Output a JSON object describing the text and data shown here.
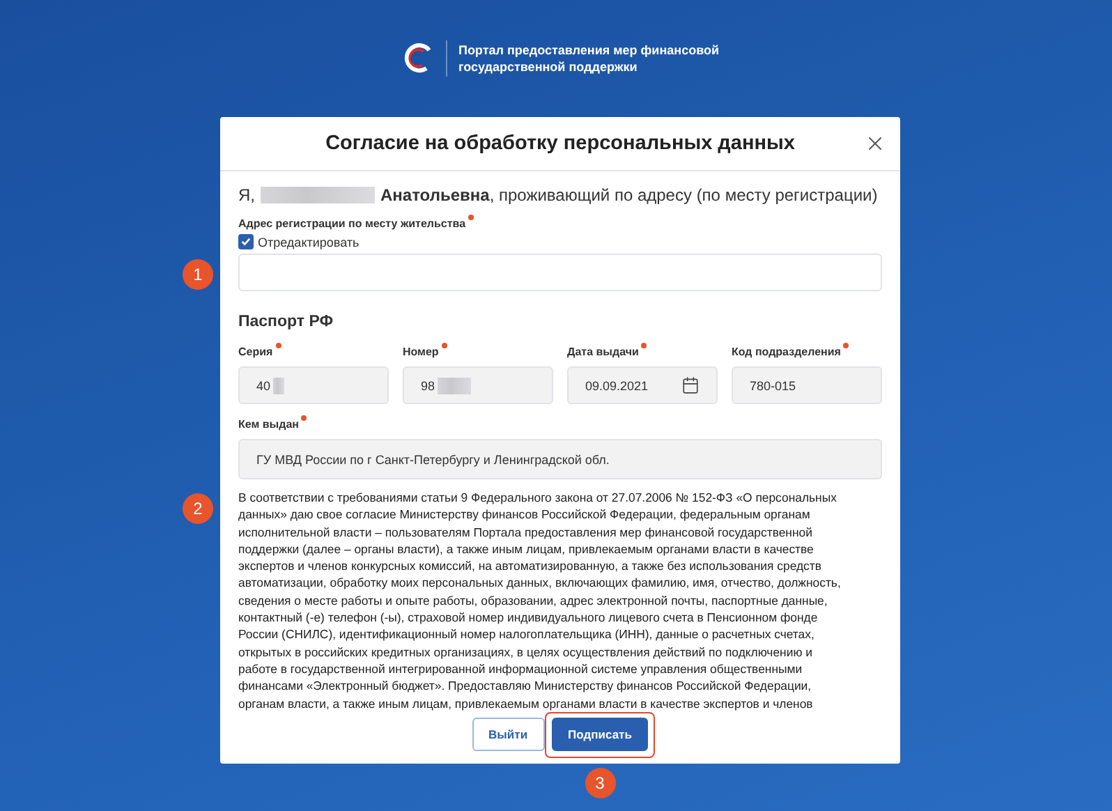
{
  "portal": {
    "title_lines": [
      "Портал предоставления мер финансовой",
      "государственной поддержки"
    ]
  },
  "modal": {
    "title": "Согласие на обработку персональных данных",
    "greeting": {
      "prefix": "Я,",
      "rest": "**Анатольевна**, проживающий по адресу (по месту регистрации)"
    },
    "address": {
      "label": "Адрес регистрации по месту жительства",
      "required": true,
      "checkbox": {
        "label": "Отредактировать",
        "checked": true
      },
      "marker": "1"
    },
    "passport": {
      "heading": "Паспорт РФ",
      "fields": [
        {
          "label": "Серия",
          "required": true,
          "value": "40",
          "redacted": true,
          "kind": "text"
        },
        {
          "label": "Номер",
          "required": true,
          "value": "98",
          "redacted": true,
          "kind": "text"
        },
        {
          "label": "Дата выдачи",
          "required": true,
          "value": "09.09.2021",
          "redacted": false,
          "kind": "date"
        },
        {
          "label": "Код подразделения",
          "required": true,
          "value": "780-015",
          "redacted": false,
          "kind": "text"
        }
      ]
    },
    "issued_by": {
      "label": "Кем выдан",
      "required": true,
      "value": "ГУ МВД России по г Санкт-Петербургу и Ленинградской обл."
    },
    "consent": {
      "marker": "2",
      "lines": [
        "В соответствии с требованиями статьи 9 Федерального закона от 27.07.2006 № 152-ФЗ «О персональных",
        "данных» даю свое согласие Министерству финансов Российской Федерации, федеральным органам",
        "исполнительной власти – пользователям Портала предоставления мер финансовой государственной",
        "поддержки (далее – органы власти), а также иным лицам, привлекаемым органами власти в качестве",
        "экспертов и членов конкурсных комиссий, на автоматизированную, а также без использования средств",
        "автоматизации, обработку моих персональных данных, включающих фамилию, имя, отчество, должность,",
        "сведения о месте работы и опыте работы, образовании, адрес электронной почты, паспортные данные,",
        "контактный (-е) телефон (-ы), страховой номер индивидуального лицевого счета в Пенсионном фонде",
        "России (СНИЛС), идентификационный номер налогоплательщика (ИНН), данные о расчетных счетах,",
        "открытых в российских кредитных организациях, в целях осуществления действий по подключению и",
        "работе в государственной интегрированной информационной системе управления общественными",
        "финансами «Электронный бюджет». Предоставляю Министерству финансов Российской Федерации,",
        "органам власти, а также иным лицам, привлекаемым органами власти в качестве экспертов и членов"
      ]
    },
    "buttons": [
      {
        "label": "Выйти",
        "kind": "secondary",
        "highlighted": false
      },
      {
        "label": "Подписать",
        "kind": "primary",
        "highlighted": true,
        "marker": "3"
      }
    ]
  }
}
